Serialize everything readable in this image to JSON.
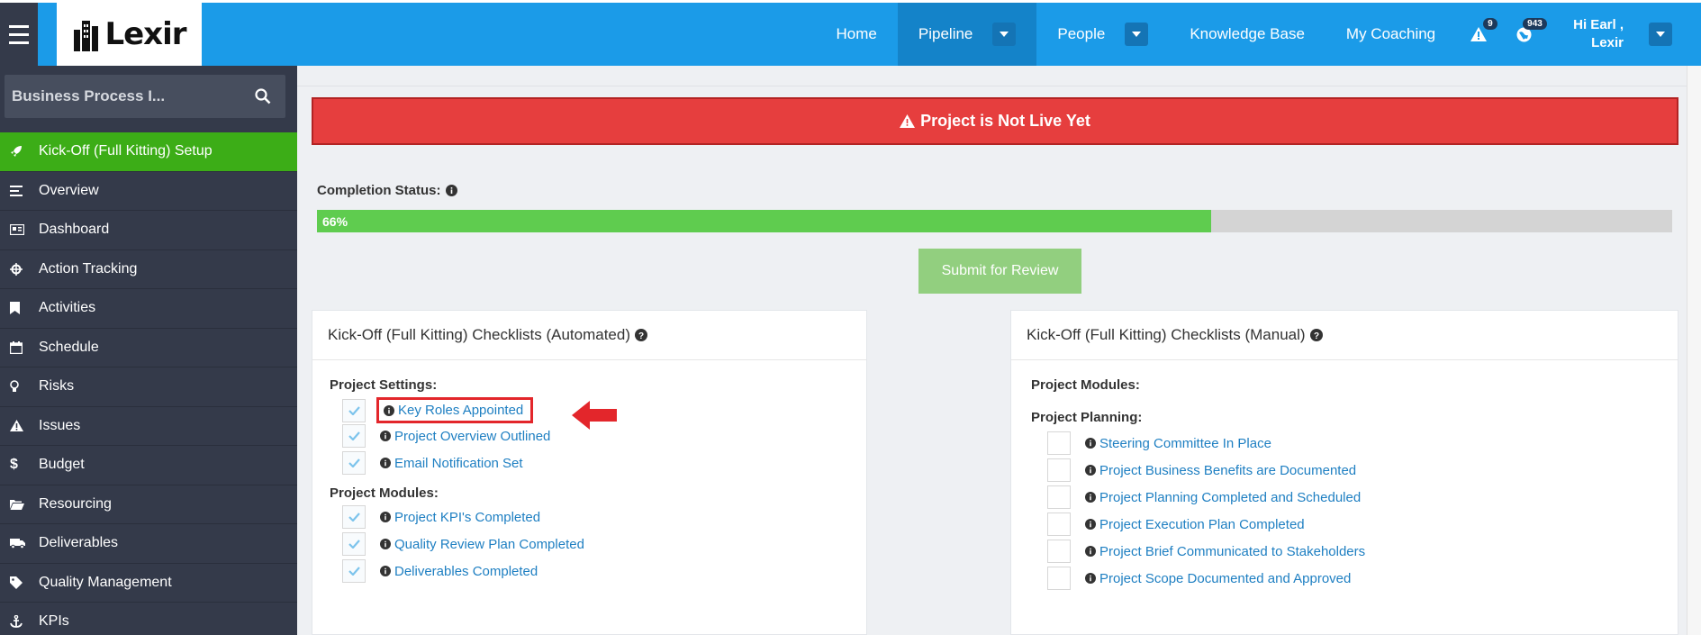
{
  "topbar": {
    "logo_text": "Lexir",
    "nav": [
      {
        "label": "Home",
        "has_dropdown": false,
        "active": false
      },
      {
        "label": "Pipeline",
        "has_dropdown": true,
        "active": true
      },
      {
        "label": "People",
        "has_dropdown": true,
        "active": false
      },
      {
        "label": "Knowledge Base",
        "has_dropdown": false,
        "active": false
      },
      {
        "label": "My Coaching",
        "has_dropdown": false,
        "active": false
      }
    ],
    "alerts_count": "9",
    "notifications_count": "943",
    "user_greeting": "Hi Earl ,",
    "user_org": "Lexir"
  },
  "sidebar": {
    "search_value": "Business Process I...",
    "items": [
      {
        "label": "Kick-Off (Full Kitting) Setup",
        "icon": "rocket-icon",
        "active": true
      },
      {
        "label": "Overview",
        "icon": "list-icon",
        "active": false
      },
      {
        "label": "Dashboard",
        "icon": "dashboard-icon",
        "active": false
      },
      {
        "label": "Action Tracking",
        "icon": "crosshair-icon",
        "active": false
      },
      {
        "label": "Activities",
        "icon": "bookmark-icon",
        "active": false
      },
      {
        "label": "Schedule",
        "icon": "calendar-icon",
        "active": false
      },
      {
        "label": "Risks",
        "icon": "lightbulb-icon",
        "active": false
      },
      {
        "label": "Issues",
        "icon": "warning-icon",
        "active": false
      },
      {
        "label": "Budget",
        "icon": "dollar-icon",
        "active": false
      },
      {
        "label": "Resourcing",
        "icon": "folder-open-icon",
        "active": false
      },
      {
        "label": "Deliverables",
        "icon": "truck-icon",
        "active": false
      },
      {
        "label": "Quality Management",
        "icon": "tag-icon",
        "active": false
      },
      {
        "label": "KPIs",
        "icon": "anchor-icon",
        "active": false
      }
    ]
  },
  "main": {
    "alert": "Project is Not Live Yet",
    "completion_label": "Completion Status:",
    "completion_percent": 66,
    "completion_text": "66%",
    "submit_label": "Submit for Review",
    "automated_panel": {
      "title": "Kick-Off (Full Kitting) Checklists (Automated)",
      "sections": [
        {
          "title": "Project Settings:",
          "items": [
            {
              "label": "Key Roles Appointed",
              "checked": true,
              "highlighted": true
            },
            {
              "label": "Project Overview Outlined",
              "checked": true
            },
            {
              "label": "Email Notification Set",
              "checked": true
            }
          ]
        },
        {
          "title": "Project Modules:",
          "items": [
            {
              "label": "Project KPI's Completed",
              "checked": true
            },
            {
              "label": "Quality Review Plan Completed",
              "checked": true
            },
            {
              "label": "Deliverables Completed",
              "checked": true
            }
          ]
        }
      ]
    },
    "manual_panel": {
      "title": "Kick-Off (Full Kitting) Checklists (Manual)",
      "sections": [
        {
          "title": "Project Modules:",
          "items": []
        },
        {
          "title": "Project Planning:",
          "items": [
            {
              "label": "Steering Committee In Place",
              "checked": false
            },
            {
              "label": "Project Business Benefits are Documented",
              "checked": false
            },
            {
              "label": "Project Planning Completed and Scheduled",
              "checked": false
            },
            {
              "label": "Project Execution Plan Completed",
              "checked": false
            },
            {
              "label": "Project Brief Communicated to Stakeholders",
              "checked": false
            },
            {
              "label": "Project Scope Documented and Approved",
              "checked": false
            }
          ]
        }
      ]
    }
  },
  "colors": {
    "topbar": "#1b9be8",
    "sidebar": "#343a4a",
    "active_menu": "#3cad17",
    "alert": "#e63e3e",
    "progress": "#5fcc4f",
    "link": "#1e7fc2"
  }
}
